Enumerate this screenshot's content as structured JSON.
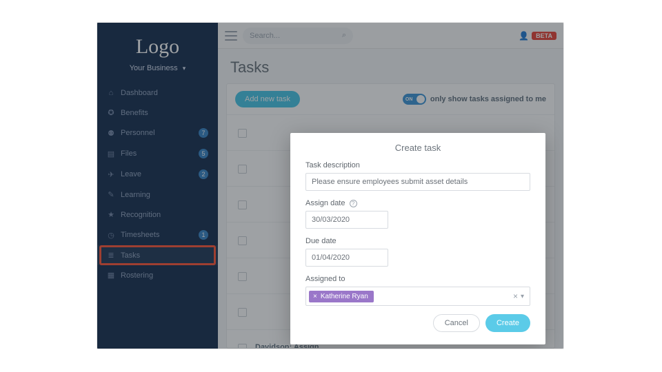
{
  "sidebar": {
    "logo": "Logo",
    "business": "Your Business",
    "items": [
      {
        "icon": "⌂",
        "label": "Dashboard"
      },
      {
        "icon": "✪",
        "label": "Benefits"
      },
      {
        "icon": "⚉",
        "label": "Personnel",
        "badge": "7"
      },
      {
        "icon": "▤",
        "label": "Files",
        "badge": "5"
      },
      {
        "icon": "✈",
        "label": "Leave",
        "badge": "2"
      },
      {
        "icon": "✎",
        "label": "Learning"
      },
      {
        "icon": "★",
        "label": "Recognition"
      },
      {
        "icon": "◷",
        "label": "Timesheets",
        "badge": "1"
      },
      {
        "icon": "≣",
        "label": "Tasks"
      },
      {
        "icon": "▦",
        "label": "Rostering"
      }
    ],
    "active_index": 8
  },
  "topbar": {
    "search_placeholder": "Search...",
    "beta_label": "BETA"
  },
  "page": {
    "title": "Tasks",
    "add_button": "Add new task",
    "filter_toggle_on": "ON",
    "filter_label": "only show tasks assigned to me",
    "row_text": "Davidson: Assign Equipment"
  },
  "modal": {
    "title": "Create task",
    "desc_label": "Task description",
    "desc_value": "Please ensure employees submit asset details",
    "assign_label": "Assign date",
    "assign_value": "30/03/2020",
    "due_label": "Due date",
    "due_value": "01/04/2020",
    "assigned_label": "Assigned to",
    "assignee": "Katherine Ryan",
    "cancel": "Cancel",
    "create": "Create"
  }
}
